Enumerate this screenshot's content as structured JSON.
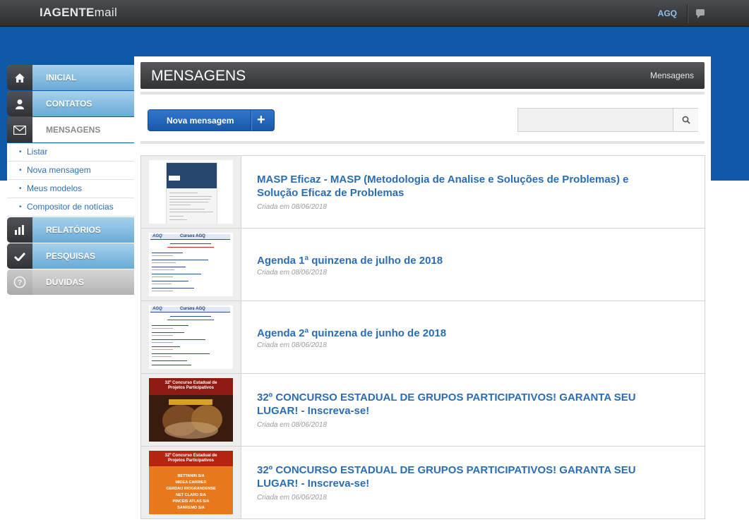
{
  "app": {
    "logo_bold": "IAGENTE",
    "logo_light": "mail",
    "user": "AGQ"
  },
  "sidebar": {
    "items": [
      {
        "label": "INICIAL",
        "icon": "home-icon"
      },
      {
        "label": "CONTATOS",
        "icon": "user-icon"
      },
      {
        "label": "MENSAGENS",
        "icon": "envelope-icon"
      },
      {
        "label": "RELATÓRIOS",
        "icon": "bar-chart-icon"
      },
      {
        "label": "PESQUISAS",
        "icon": "check-icon"
      },
      {
        "label": "DÚVIDAS",
        "icon": "question-icon"
      }
    ],
    "submenu": [
      "Listar",
      "Nova mensagem",
      "Meus modelos",
      "Compositor de notícias"
    ]
  },
  "page": {
    "title": "MENSAGENS",
    "breadcrumb": "Mensagens"
  },
  "toolbar": {
    "new_message": "Nova mensagem",
    "search_placeholder": ""
  },
  "messages": [
    {
      "title": "MASP Eficaz - MASP (Metodologia de Analise e Soluções de Problemas) e Solução Eficaz de Problemas",
      "date": "Criada em 08/06/2018"
    },
    {
      "title": "Agenda 1ª quinzena de julho de 2018",
      "date": "Criada em 08/06/2018"
    },
    {
      "title": "Agenda 2ª quinzena de junho de 2018",
      "date": "Criada em 08/06/2018"
    },
    {
      "title": "32º CONCURSO ESTADUAL DE GRUPOS PARTICIPATIVOS! GARANTA SEU LUGAR! - Inscreva-se!",
      "date": "Criada em 08/06/2018"
    },
    {
      "title": "32º CONCURSO ESTADUAL DE GRUPOS PARTICIPATIVOS! GARANTA SEU LUGAR! - Inscreva-se!",
      "date": "Criada em 06/06/2018"
    }
  ],
  "thumbnails": {
    "agenda_header_left": "AGQ",
    "agenda_header_right": "Cursos AGQ",
    "contest_line1": "32º Concurso Estadual de",
    "contest_line2": "Projetos Participativos",
    "contest_companies": [
      "BETTANIN S/A",
      "MIDEA CARRIER",
      "GERDAU RIOGRANDENSE",
      "NET CLARO S/A",
      "PINCEIS ATLAS S/A",
      "SANREMO S/A"
    ]
  },
  "colors": {
    "brand_blue": "#0f58a8",
    "link": "#2a6db4",
    "nav_active_text": "#8a8a8a"
  }
}
